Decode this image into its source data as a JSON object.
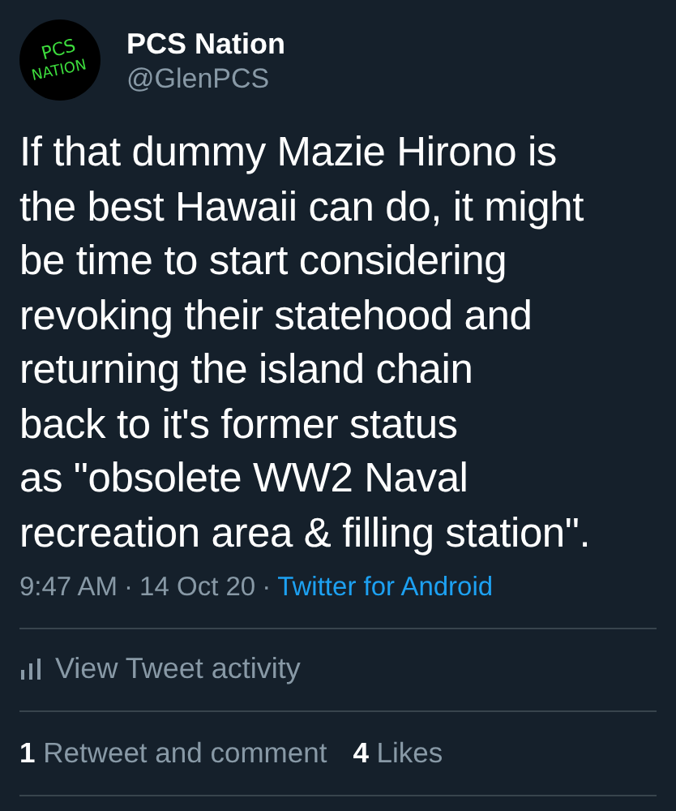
{
  "author": {
    "avatar": {
      "text_1": "PCS",
      "text_2": "NATION"
    },
    "name": "PCS Nation",
    "handle": "@GlenPCS"
  },
  "tweet_lines": [
    "If that dummy Mazie Hirono is",
    "the best Hawaii can do, it might",
    "be time to start considering",
    "revoking their statehood and",
    "returning the island chain",
    "back to it's former status",
    "as \"obsolete WW2 Naval",
    "recreation area & filling station\"."
  ],
  "meta": {
    "time": "9:47 AM",
    "separator_1": "·",
    "date": "14 Oct 20",
    "separator_2": "·",
    "source": "Twitter for Android"
  },
  "activity": {
    "label": "View Tweet activity"
  },
  "stats": [
    {
      "count": "1",
      "label": "Retweet and comment"
    },
    {
      "count": "4",
      "label": "Likes"
    }
  ]
}
